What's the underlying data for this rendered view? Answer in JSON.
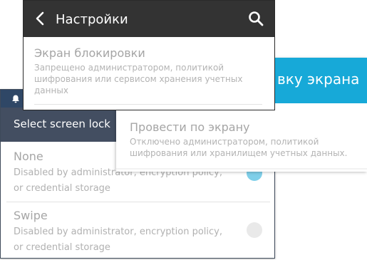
{
  "english_screen": {
    "title": "Select screen lock",
    "items": [
      {
        "label": "None",
        "description": "Disabled by administrator, encryption policy, or credential storage",
        "selected": true
      },
      {
        "label": "Swipe",
        "description": "Disabled by administrator, encryption policy, or credential storage",
        "selected": false
      }
    ],
    "colors": {
      "statusbar": "#2f4766",
      "header": "#434e61",
      "radio_selected": "#7fcfe9"
    }
  },
  "russian_lock_screen": {
    "title": "вку экрана",
    "item": {
      "label": "Провести по экрану",
      "description": "Отключено администратором, политикой шифрования или хранилищем учетных данных."
    },
    "colors": {
      "header": "#17a9d8"
    }
  },
  "russian_settings": {
    "title": "Настройки",
    "item": {
      "label": "Экран блокировки",
      "description": "Запрещено администратором, политикой шифрования или сервисом хранения учетных данных"
    },
    "icons": {
      "back": "chevron-left-icon",
      "search": "search-icon",
      "notification": "bell-icon"
    },
    "colors": {
      "header": "#333333"
    }
  }
}
